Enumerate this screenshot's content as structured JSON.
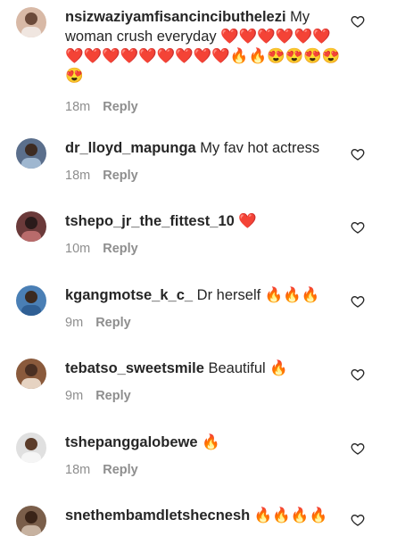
{
  "comments": [
    {
      "username": "nsizwaziyamfisancincibuthelezi",
      "text": "My woman crush everyday",
      "emoji": "❤️❤️❤️❤️❤️❤️❤️❤️❤️❤️❤️❤️❤️❤️❤️🔥🔥😍😍😍😍😍",
      "time": "18m",
      "reply": "Reply",
      "avatar_color": "#d8b9a6"
    },
    {
      "username": "dr_lloyd_mapunga",
      "text": "My fav hot actress",
      "emoji": "",
      "time": "18m",
      "reply": "Reply",
      "avatar_color": "#5b6f8c"
    },
    {
      "username": "tshepo_jr_the_fittest_10",
      "text": "",
      "emoji": "❤️",
      "time": "10m",
      "reply": "Reply",
      "avatar_color": "#6b3a3a"
    },
    {
      "username": "kgangmotse_k_c_",
      "text": "Dr herself",
      "emoji": "🔥🔥🔥",
      "time": "9m",
      "reply": "Reply",
      "avatar_color": "#4a7fb5"
    },
    {
      "username": "tebatso_sweetsmile",
      "text": "Beautiful",
      "emoji": "🔥",
      "time": "9m",
      "reply": "Reply",
      "avatar_color": "#8a5a3c"
    },
    {
      "username": "tshepanggalobewe",
      "text": "",
      "emoji": "🔥",
      "time": "18m",
      "reply": "Reply",
      "avatar_color": "#e0e0e0"
    },
    {
      "username": "snethembamdletshecnesh",
      "text": "",
      "emoji": "🔥🔥🔥🔥",
      "time": "",
      "reply": "",
      "avatar_color": "#7a5e4a"
    }
  ]
}
